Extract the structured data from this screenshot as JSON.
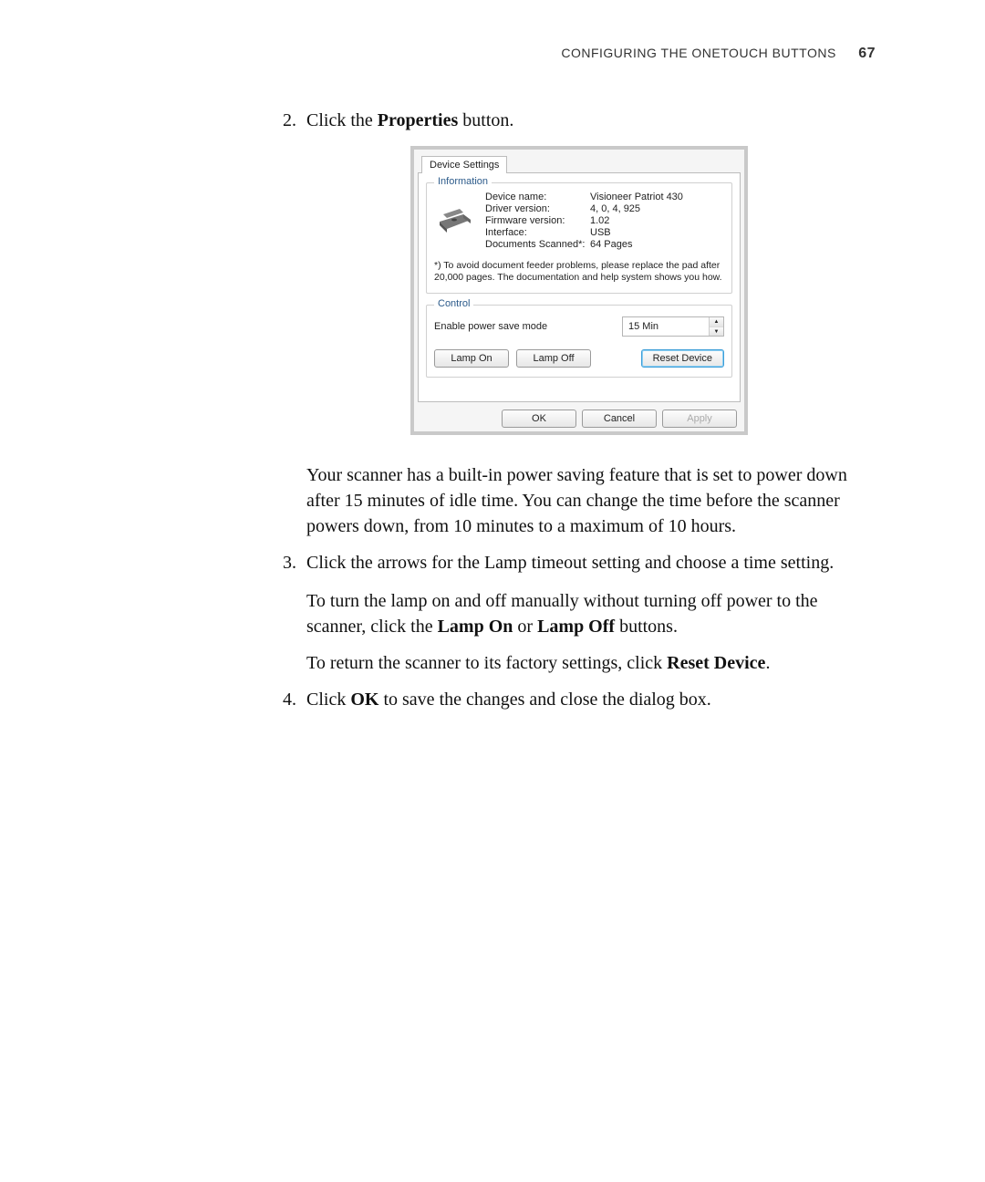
{
  "header": {
    "title_small": "CONFIGURING THE ONETOUCH BUTTONS",
    "page_number": "67"
  },
  "steps": {
    "s2": {
      "num": "2.",
      "text_before": "Click the ",
      "bold": "Properties",
      "text_after": " button."
    },
    "p1": "Your scanner has a built-in power saving feature that is set to power down after 15 minutes of idle time. You can change the time before the scanner powers down, from 10 minutes to a maximum of 10 hours.",
    "s3": {
      "num": "3.",
      "text": "Click the arrows for the Lamp timeout setting and choose a time setting."
    },
    "p2_a": "To turn the lamp on and off manually without turning off power to the scanner, click the ",
    "p2_b1": "Lamp On",
    "p2_mid": " or ",
    "p2_b2": "Lamp Off",
    "p2_end": " buttons.",
    "p3_a": "To return the scanner to its factory settings, click ",
    "p3_b": "Reset Device",
    "p3_end": ".",
    "s4": {
      "num": "4.",
      "pre": "Click ",
      "bold": "OK",
      "post": " to save the changes and close the dialog box."
    }
  },
  "dialog": {
    "tab": "Device Settings",
    "info": {
      "title": "Information",
      "rows": {
        "device_name_k": "Device name:",
        "device_name_v": "Visioneer Patriot 430",
        "driver_k": "Driver version:",
        "driver_v": "4, 0, 4, 925",
        "firmware_k": "Firmware version:",
        "firmware_v": "1.02",
        "interface_k": "Interface:",
        "interface_v": "USB",
        "docs_k": "Documents Scanned*:",
        "docs_v": "64 Pages"
      },
      "footnote": "*)  To avoid document feeder problems, please replace the pad after 20,000 pages. The documentation and help system shows you how."
    },
    "control": {
      "title": "Control",
      "power_label": "Enable power save mode",
      "power_value": "15 Min",
      "lamp_on": "Lamp On",
      "lamp_off": "Lamp Off",
      "reset": "Reset Device"
    },
    "footer": {
      "ok": "OK",
      "cancel": "Cancel",
      "apply": "Apply"
    }
  }
}
